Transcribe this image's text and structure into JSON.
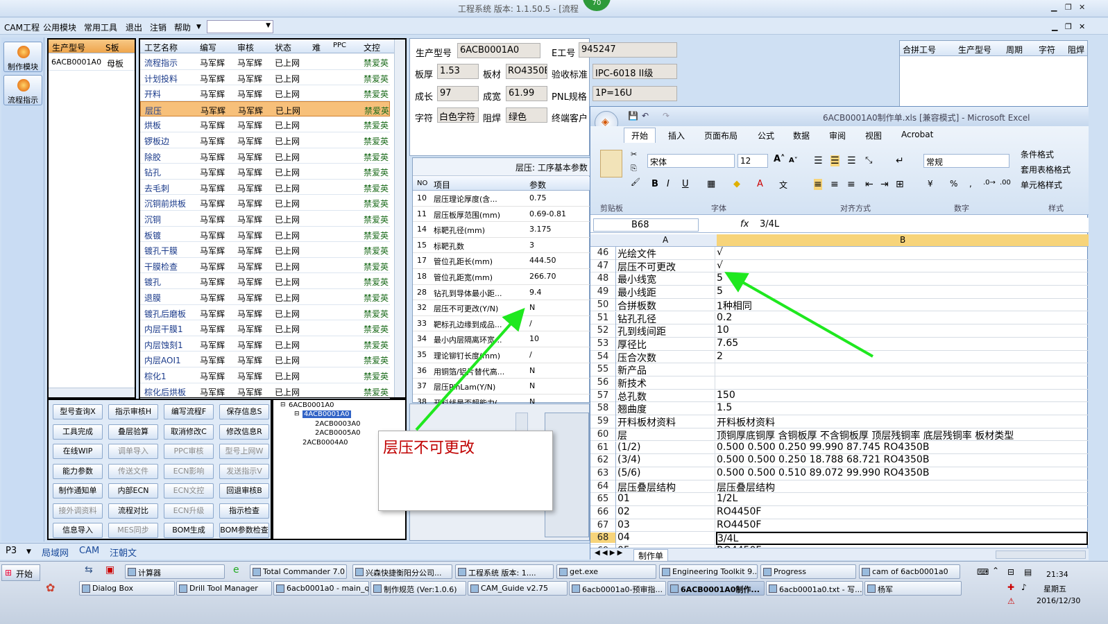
{
  "window": {
    "title": "工程系统  版本: 1.1.50.5 - [流程",
    "badge": "70"
  },
  "menu": [
    "CAM工程",
    "公用模块",
    "常用工具",
    "退出",
    "注销",
    "帮助"
  ],
  "leftbar": [
    "制作模块",
    "流程指示"
  ],
  "product_grid": {
    "headers": [
      "生产型号",
      "S板"
    ],
    "rows": [
      [
        "6ACB0001A0",
        "母板"
      ]
    ]
  },
  "process_grid": {
    "headers": [
      "工艺名称",
      "编写",
      "审核",
      "状态",
      "难",
      "PPC",
      "文控"
    ],
    "rows": [
      [
        "流程指示",
        "马军辉",
        "马军辉",
        "已上网",
        "",
        "",
        "禁爱英"
      ],
      [
        "计划投料",
        "马军辉",
        "马军辉",
        "已上网",
        "",
        "",
        "禁爱英"
      ],
      [
        "开料",
        "马军辉",
        "马军辉",
        "已上网",
        "",
        "",
        "禁爱英"
      ],
      [
        "层压",
        "马军辉",
        "马军辉",
        "已上网",
        "",
        "",
        "禁爱英"
      ],
      [
        "烘板",
        "马军辉",
        "马军辉",
        "已上网",
        "",
        "",
        "禁爱英"
      ],
      [
        "锣板边",
        "马军辉",
        "马军辉",
        "已上网",
        "",
        "",
        "禁爱英"
      ],
      [
        "除胶",
        "马军辉",
        "马军辉",
        "已上网",
        "",
        "",
        "禁爱英"
      ],
      [
        "钻孔",
        "马军辉",
        "马军辉",
        "已上网",
        "",
        "",
        "禁爱英"
      ],
      [
        "去毛刺",
        "马军辉",
        "马军辉",
        "已上网",
        "",
        "",
        "禁爱英"
      ],
      [
        "沉铜前烘板",
        "马军辉",
        "马军辉",
        "已上网",
        "",
        "",
        "禁爱英"
      ],
      [
        "沉铜",
        "马军辉",
        "马军辉",
        "已上网",
        "",
        "",
        "禁爱英"
      ],
      [
        "板镀",
        "马军辉",
        "马军辉",
        "已上网",
        "",
        "",
        "禁爱英"
      ],
      [
        "镀孔干膜",
        "马军辉",
        "马军辉",
        "已上网",
        "",
        "",
        "禁爱英"
      ],
      [
        "干膜检查",
        "马军辉",
        "马军辉",
        "已上网",
        "",
        "",
        "禁爱英"
      ],
      [
        "镀孔",
        "马军辉",
        "马军辉",
        "已上网",
        "",
        "",
        "禁爱英"
      ],
      [
        "退膜",
        "马军辉",
        "马军辉",
        "已上网",
        "",
        "",
        "禁爱英"
      ],
      [
        "镀孔后磨板",
        "马军辉",
        "马军辉",
        "已上网",
        "",
        "",
        "禁爱英"
      ],
      [
        "内层干膜1",
        "马军辉",
        "马军辉",
        "已上网",
        "",
        "",
        "禁爱英"
      ],
      [
        "内层蚀刻1",
        "马军辉",
        "马军辉",
        "已上网",
        "",
        "",
        "禁爱英"
      ],
      [
        "内层AOI1",
        "马军辉",
        "马军辉",
        "已上网",
        "",
        "",
        "禁爱英"
      ],
      [
        "棕化1",
        "马军辉",
        "马军辉",
        "已上网",
        "",
        "",
        "禁爱英"
      ],
      [
        "棕化后烘板",
        "马军辉",
        "马军辉",
        "已上网",
        "",
        "",
        "禁爱英"
      ]
    ],
    "selected": 3
  },
  "buttons": [
    [
      "型号查询X",
      "指示审核H",
      "编写流程F",
      "保存信息S"
    ],
    [
      "工具完成",
      "叠层验算",
      "取消修改C",
      "修改信息R"
    ],
    [
      "在线WIP",
      "调单导入",
      "PPC审核",
      "型号上网W"
    ],
    [
      "能力参数",
      "传送文件",
      "ECN影响",
      "发送指示V"
    ],
    [
      "制作通知单",
      "内部ECN",
      "ECN文控",
      "回退审核B"
    ],
    [
      "接外调资料",
      "流程对比",
      "ECN升级",
      "指示检查"
    ],
    [
      "信息导入",
      "MES同步",
      "BOM生成",
      "BOM参数检查"
    ]
  ],
  "tree": [
    "6ACB0001A0",
    "4ACB0001A0",
    "2ACB0003A0",
    "2ACB0005A0",
    "2ACB0004A0"
  ],
  "info": {
    "prod_label": "生产型号",
    "prod": "6ACB0001A0",
    "eng_label": "E工号",
    "eng": "945247",
    "thick_label": "板厚",
    "thick": "1.53",
    "mat_label": "板材",
    "mat": "RO4350B",
    "std_label": "验收标准",
    "std": "IPC-6018 II级",
    "len_label": "成长",
    "len": "97",
    "wid_label": "成宽",
    "wid": "61.99",
    "pnl_label": "PNL规格",
    "pnl": "1P=16U",
    "char_label": "字符",
    "char": "白色字符",
    "mask_label": "阻焊",
    "mask": "绿色",
    "cust_label": "终端客户"
  },
  "right_table": [
    "合拼工号",
    "生产型号",
    "周期",
    "字符",
    "阻焊"
  ],
  "params": {
    "title": "层压: 工序基本参数",
    "headers": [
      "NO",
      "项目",
      "参数"
    ],
    "rows": [
      [
        "10",
        "层压理论厚度(含...",
        "0.75"
      ],
      [
        "11",
        "层压板厚范围(mm)",
        "0.69-0.81"
      ],
      [
        "14",
        "标靶孔径(mm)",
        "3.175"
      ],
      [
        "15",
        "标靶孔数",
        "3"
      ],
      [
        "17",
        "管位孔距长(mm)",
        "444.50"
      ],
      [
        "18",
        "管位孔距宽(mm)",
        "266.70"
      ],
      [
        "28",
        "钻孔到导体最小距...",
        "9.4"
      ],
      [
        "32",
        "层压不可更改(Y/N)",
        "N"
      ],
      [
        "33",
        "靶标孔边缘到成品...",
        "/"
      ],
      [
        "34",
        "最小内层隔离环宽...",
        "10"
      ],
      [
        "35",
        "理论铆钉长度(mm)",
        "/"
      ],
      [
        "36",
        "用铜箔/铝片替代高...",
        "N"
      ],
      [
        "37",
        "层压PinLam(Y/N)",
        "N"
      ],
      [
        "38",
        "开料线是否超能力(...",
        "N"
      ]
    ]
  },
  "popup": "层压不可更改",
  "excel": {
    "title": "6ACB0001A0制作单.xls [兼容模式] - Microsoft Excel",
    "tabs": [
      "开始",
      "插入",
      "页面布局",
      "公式",
      "数据",
      "审阅",
      "视图",
      "Acrobat"
    ],
    "font": "宋体",
    "size": "12",
    "numfmt": "常规",
    "styles": [
      "条件格式",
      "套用表格格式",
      "单元格样式"
    ],
    "groups": [
      "剪贴板",
      "字体",
      "对齐方式",
      "数字",
      "样式"
    ],
    "cellref": "B68",
    "formula": "3/4L",
    "sheet": "制作单",
    "rows": [
      [
        "46",
        "光绘文件",
        "√"
      ],
      [
        "47",
        "层压不可更改",
        "√"
      ],
      [
        "48",
        "最小线宽",
        "5"
      ],
      [
        "49",
        "最小线距",
        "5"
      ],
      [
        "50",
        "合拼板数",
        "1种相同"
      ],
      [
        "51",
        "钻孔孔径",
        "0.2"
      ],
      [
        "52",
        "孔到线间距",
        "10"
      ],
      [
        "53",
        "厚径比",
        "7.65"
      ],
      [
        "54",
        "压合次数",
        "2"
      ],
      [
        "55",
        "新产品",
        ""
      ],
      [
        "56",
        "新技术",
        ""
      ],
      [
        "57",
        "总孔数",
        "150"
      ],
      [
        "58",
        "翘曲度",
        "1.5"
      ],
      [
        "59",
        "开料板材资料",
        "开料板材资料"
      ],
      [
        "60",
        "层",
        "顶铜厚底铜厚  含铜板厚  不含铜板厚  顶层残铜率  底层残铜率  板材类型"
      ],
      [
        "61",
        "(1/2)",
        "0.500   0.500         0.250       99.990      87.745        RO4350B"
      ],
      [
        "62",
        "(3/4)",
        "0.500   0.500         0.250       18.788      68.721        RO4350B"
      ],
      [
        "63",
        "(5/6)",
        "0.500   0.500         0.510       89.072      99.990        RO4350B"
      ],
      [
        "64",
        "层压叠层结构",
        "层压叠层结构"
      ],
      [
        "65",
        "01",
        "1/2L"
      ],
      [
        "66",
        "02",
        "RO4450F"
      ],
      [
        "67",
        "03",
        "RO4450F"
      ],
      [
        "68",
        "04",
        "3/4L"
      ],
      [
        "69",
        "05",
        "RO4450F"
      ]
    ]
  },
  "bottom_tabs": [
    "P3",
    "局域网",
    "CAM",
    "汪朝文"
  ],
  "taskbar": {
    "start": "开始",
    "row1": [
      "计算器",
      "Total Commander 7.0 ...",
      "兴森快捷衡阳分公司...",
      "工程系统 版本: 1....",
      "get.exe",
      "Engineering Toolkit 9....",
      "Progress",
      "cam of 6acb0001a0"
    ],
    "row2": [
      "Dialog Box",
      "Drill Tool Manager",
      "6acb0001a0 - main_qa",
      "制作规范 (Ver:1.0.6)",
      "CAM_Guide v2.75",
      "6acb0001a0-预审指...",
      "6ACB0001A0制作...",
      "6acb0001a0.txt - 写...",
      "杨军"
    ],
    "active": "6ACB0001A0制作...",
    "time": "21:34",
    "weekday": "星期五",
    "date": "2016/12/30"
  }
}
